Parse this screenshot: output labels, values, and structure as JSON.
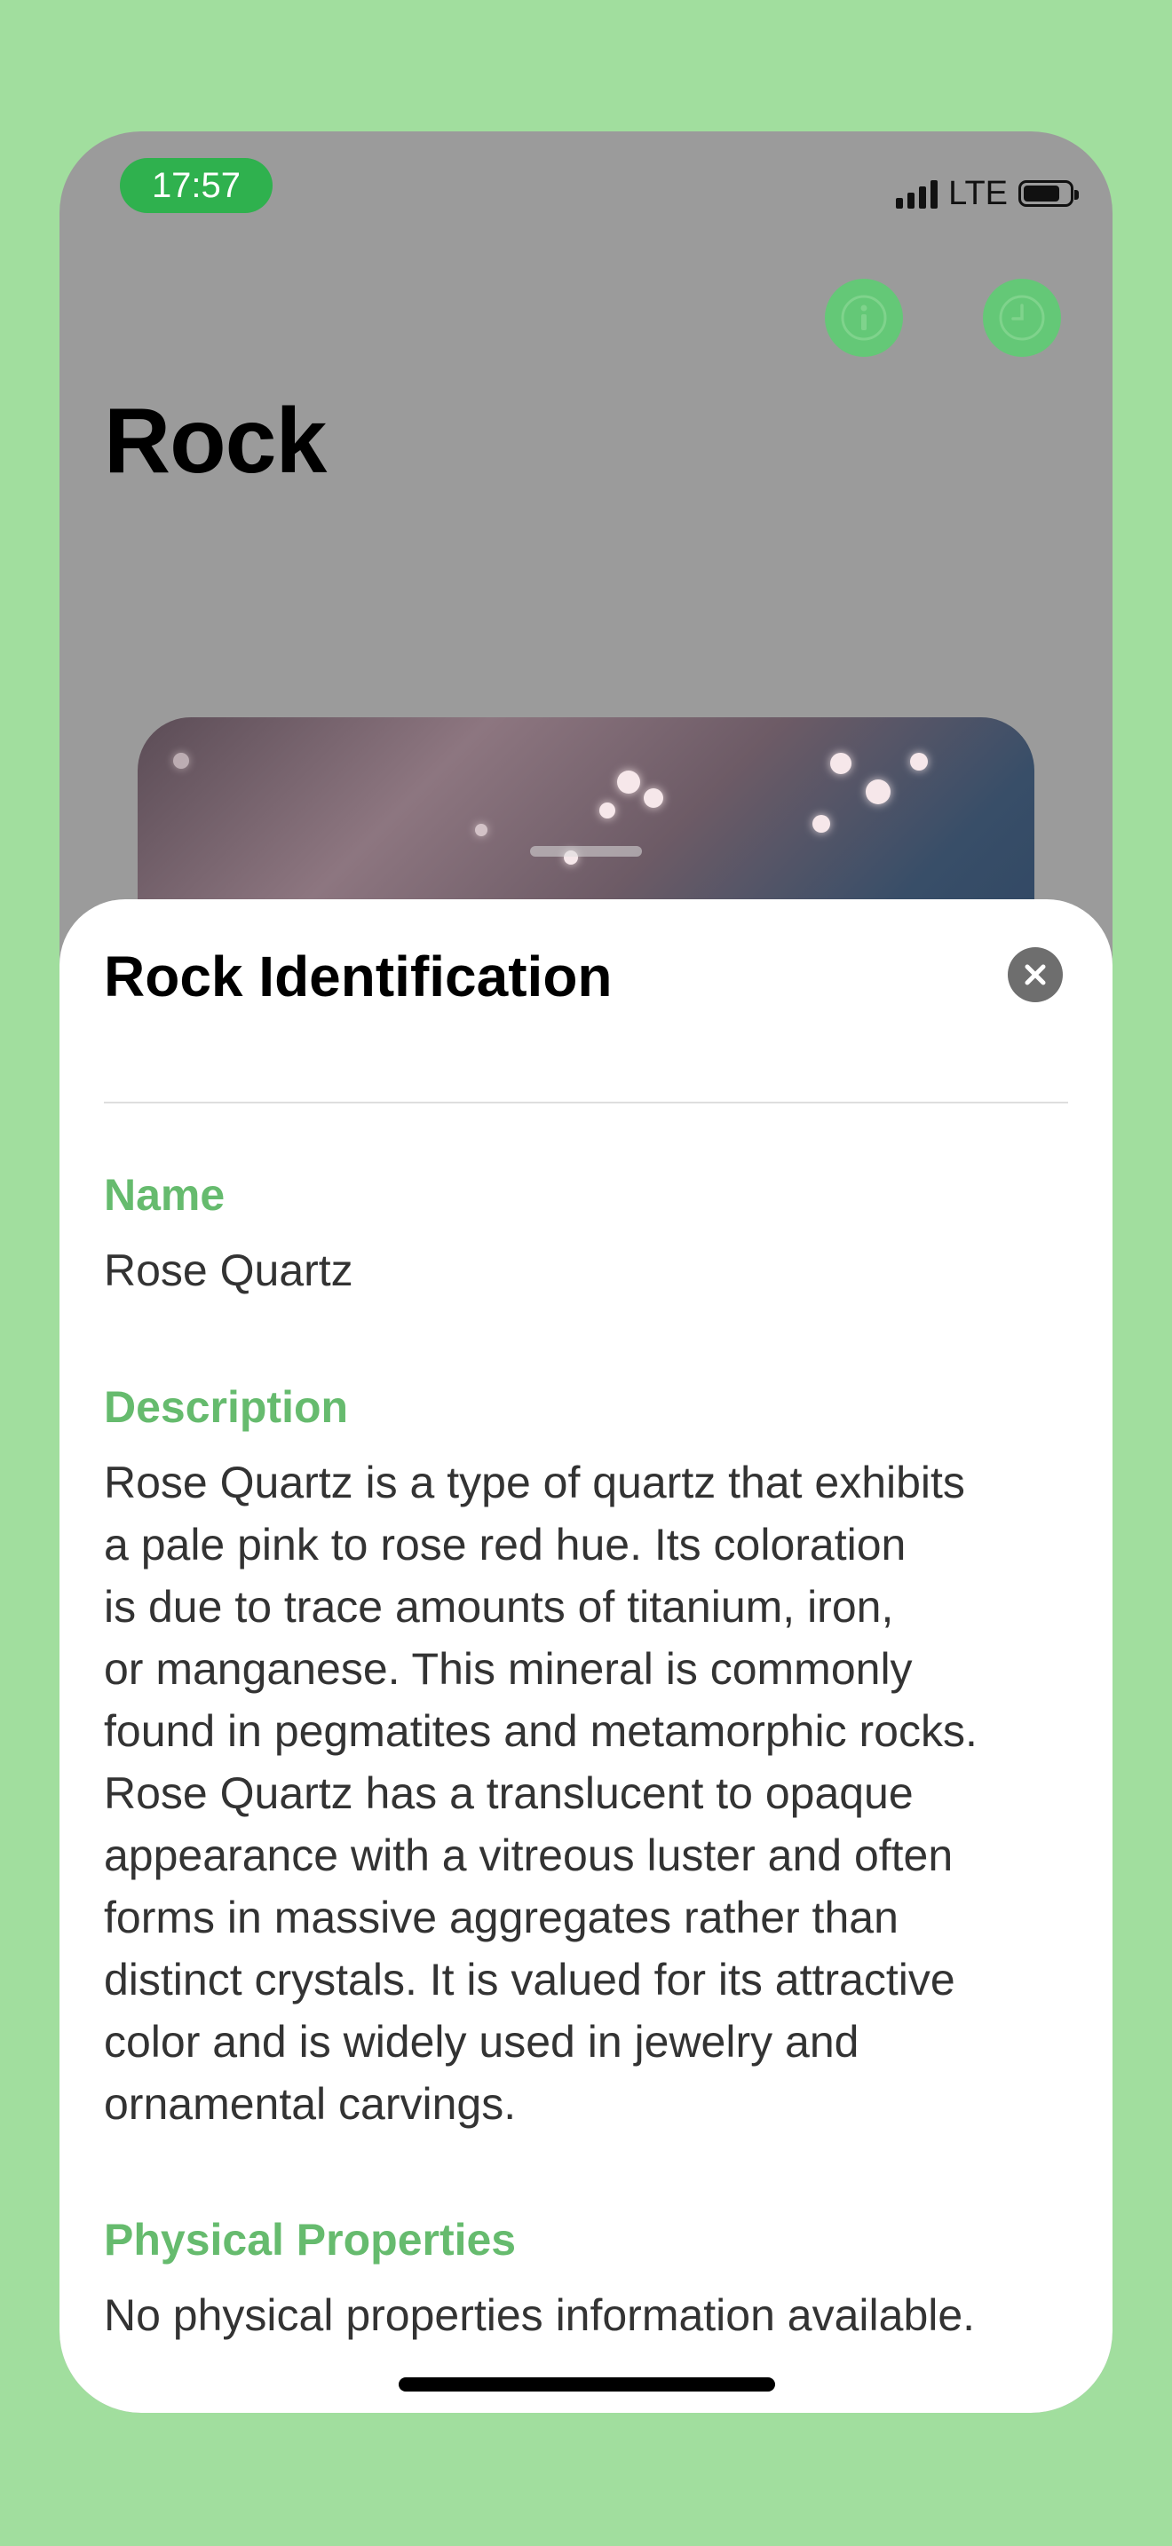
{
  "status_bar": {
    "time": "17:57",
    "network": "LTE"
  },
  "header": {
    "title": "Rock",
    "info_icon": "info-icon",
    "history_icon": "clock-icon"
  },
  "sheet": {
    "title": "Rock Identification",
    "close_icon": "close-icon",
    "sections": [
      {
        "label": "Name",
        "text": "Rose Quartz"
      },
      {
        "label": "Description",
        "text": "Rose Quartz is a type of quartz that exhibits\na pale pink to rose red hue. Its coloration\nis due to trace amounts of titanium, iron,\nor manganese. This mineral is commonly\nfound in pegmatites and metamorphic rocks.\nRose Quartz has a translucent to opaque\nappearance with a vitreous luster and often\nforms in massive aggregates rather than\ndistinct crystals. It is valued for its attractive\ncolor and is widely used in jewelry and\nornamental carvings."
      },
      {
        "label": "Physical Properties",
        "text": "No physical properties information available."
      }
    ]
  },
  "colors": {
    "background": "#a1de9e",
    "accent": "#66bb6e",
    "status_pill": "#2fb14e"
  }
}
